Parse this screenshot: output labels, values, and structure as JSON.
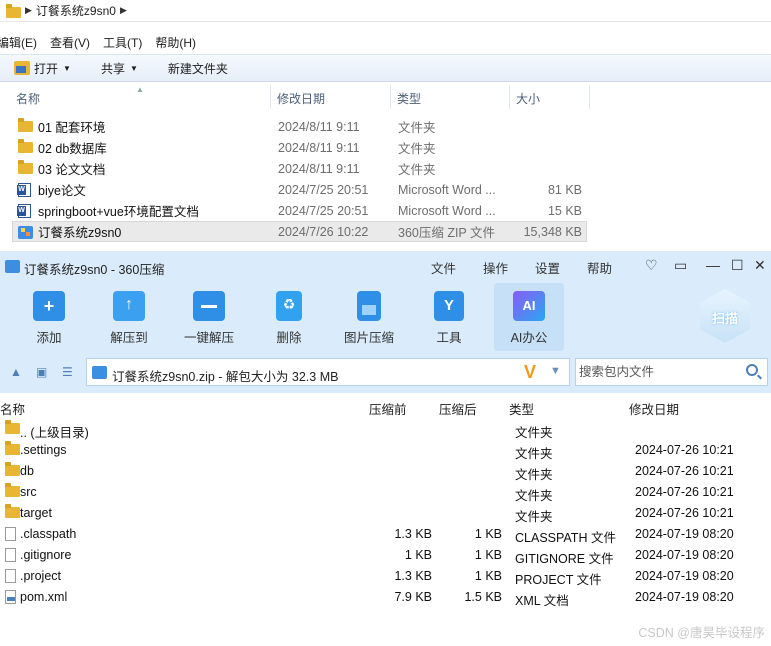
{
  "explorer": {
    "breadcrumb": "订餐系统z9sn0",
    "menu": [
      "编辑(E)",
      "查看(V)",
      "工具(T)",
      "帮助(H)"
    ],
    "toolbar": {
      "open": "打开",
      "share": "共享",
      "new_folder": "新建文件夹"
    },
    "columns": {
      "name": "名称",
      "date": "修改日期",
      "type": "类型",
      "size": "大小"
    },
    "rows": [
      {
        "name": "01 配套环境",
        "date": "2024/8/11 9:11",
        "type": "文件夹",
        "size": "",
        "icon": "folder-icon"
      },
      {
        "name": "02 db数据库",
        "date": "2024/8/11 9:11",
        "type": "文件夹",
        "size": "",
        "icon": "folder-icon"
      },
      {
        "name": "03 论文文档",
        "date": "2024/8/11 9:11",
        "type": "文件夹",
        "size": "",
        "icon": "folder-icon"
      },
      {
        "name": "biye论文",
        "date": "2024/7/25 20:51",
        "type": "Microsoft Word ...",
        "size": "81 KB",
        "icon": "word-doc-icon"
      },
      {
        "name": "springboot+vue环境配置文档",
        "date": "2024/7/25 20:51",
        "type": "Microsoft Word ...",
        "size": "15 KB",
        "icon": "word-doc-icon"
      },
      {
        "name": "订餐系统z9sn0",
        "date": "2024/7/26 10:22",
        "type": "360压缩 ZIP 文件",
        "size": "15,348 KB",
        "icon": "zip-archive-icon"
      }
    ]
  },
  "zip": {
    "window_title": "订餐系统z9sn0 - 360压缩",
    "menu": [
      "文件",
      "操作",
      "设置",
      "帮助"
    ],
    "ribbon": [
      "添加",
      "解压到",
      "一键解压",
      "删除",
      "图片压缩",
      "工具",
      "AI办公"
    ],
    "scan_label": "扫描",
    "path": "订餐系统z9sn0.zip - 解包大小为 32.3 MB",
    "search_placeholder": "搜索包内文件",
    "columns": {
      "name": "名称",
      "before": "压缩前",
      "after": "压缩后",
      "type": "类型",
      "date": "修改日期"
    },
    "rows": [
      {
        "name": ".. (上级目录)",
        "before": "",
        "after": "",
        "type": "文件夹",
        "date": "",
        "icon": "folder-icon"
      },
      {
        "name": ".settings",
        "before": "",
        "after": "",
        "type": "文件夹",
        "date": "2024-07-26 10:21",
        "icon": "folder-icon"
      },
      {
        "name": "db",
        "before": "",
        "after": "",
        "type": "文件夹",
        "date": "2024-07-26 10:21",
        "icon": "folder-icon"
      },
      {
        "name": "src",
        "before": "",
        "after": "",
        "type": "文件夹",
        "date": "2024-07-26 10:21",
        "icon": "folder-icon"
      },
      {
        "name": "target",
        "before": "",
        "after": "",
        "type": "文件夹",
        "date": "2024-07-26 10:21",
        "icon": "folder-icon"
      },
      {
        "name": ".classpath",
        "before": "1.3 KB",
        "after": "1 KB",
        "type": "CLASSPATH 文件",
        "date": "2024-07-19 08:20",
        "icon": "file-icon"
      },
      {
        "name": ".gitignore",
        "before": "1 KB",
        "after": "1 KB",
        "type": "GITIGNORE 文件",
        "date": "2024-07-19 08:20",
        "icon": "file-icon"
      },
      {
        "name": ".project",
        "before": "1.3 KB",
        "after": "1 KB",
        "type": "PROJECT 文件",
        "date": "2024-07-19 08:20",
        "icon": "file-icon"
      },
      {
        "name": "pom.xml",
        "before": "7.9 KB",
        "after": "1.5 KB",
        "type": "XML 文档",
        "date": "2024-07-19 08:20",
        "icon": "xml-file-icon"
      }
    ]
  },
  "watermark": "CSDN @唐昊毕设程序"
}
